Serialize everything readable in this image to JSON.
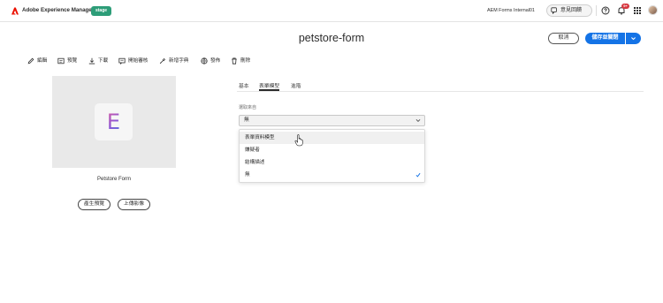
{
  "header": {
    "app_title": "Adobe Experience Manager",
    "env_badge": "stage",
    "org_name": "AEM Forms Internal01",
    "feedback_label": "意見回饋",
    "notification_count": "9+"
  },
  "page": {
    "title": "petstore-form",
    "cancel_label": "取消",
    "save_label": "儲存並關閉"
  },
  "toolbar": {
    "items": [
      {
        "label": "編輯",
        "icon": "pencil-icon"
      },
      {
        "label": "預覽",
        "icon": "preview-icon"
      },
      {
        "label": "下載",
        "icon": "download-icon"
      },
      {
        "label": "開始審核",
        "icon": "review-icon"
      },
      {
        "label": "新增字典",
        "icon": "dictionary-icon"
      },
      {
        "label": "發佈",
        "icon": "globe-icon"
      },
      {
        "label": "刪除",
        "icon": "trash-icon"
      }
    ]
  },
  "card": {
    "thumbnail_letter": "E",
    "name": "Petstore Form",
    "generate_preview_label": "產生預覽",
    "upload_image_label": "上傳影像"
  },
  "tabs": [
    {
      "label": "基本",
      "active": false
    },
    {
      "label": "表單模型",
      "active": true
    },
    {
      "label": "進階",
      "active": false
    }
  ],
  "form_model": {
    "field_label": "選取來自",
    "selected_value": "無",
    "options": [
      {
        "label": "表單資料模型",
        "hovered": true,
        "selected": false
      },
      {
        "label": "嫌疑者",
        "hovered": false,
        "selected": false
      },
      {
        "label": "結構描述",
        "hovered": false,
        "selected": false
      },
      {
        "label": "無",
        "hovered": false,
        "selected": true
      }
    ]
  },
  "colors": {
    "accent": "#1473e6",
    "env_badge": "#2d9d78",
    "notification": "#d7373f",
    "adobe_red": "#eb1000"
  }
}
